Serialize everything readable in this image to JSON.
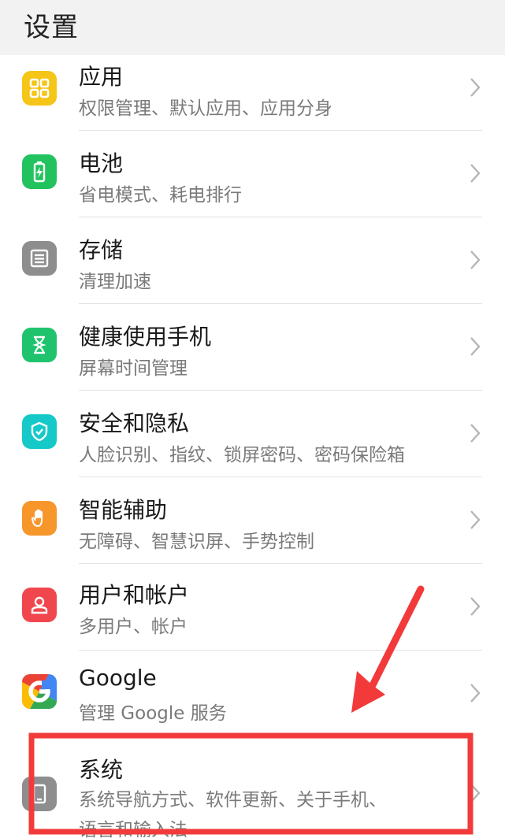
{
  "header": {
    "title": "设置"
  },
  "items": [
    {
      "label": "应用",
      "desc": "权限管理、默认应用、应用分身",
      "icon": "apps-grid-icon",
      "color": "#f5c518"
    },
    {
      "label": "电池",
      "desc": "省电模式、耗电排行",
      "icon": "battery-icon",
      "color": "#22c35e"
    },
    {
      "label": "存储",
      "desc": "清理加速",
      "icon": "storage-icon",
      "color": "#8e8e8e"
    },
    {
      "label": "健康使用手机",
      "desc": "屏幕时间管理",
      "icon": "hourglass-icon",
      "color": "#1fc36e"
    },
    {
      "label": "安全和隐私",
      "desc": "人脸识别、指纹、锁屏密码、密码保险箱",
      "icon": "shield-icon",
      "color": "#16c9c9"
    },
    {
      "label": "智能辅助",
      "desc": "无障碍、智慧识屏、手势控制",
      "icon": "hand-icon",
      "color": "#f7962b"
    },
    {
      "label": "用户和帐户",
      "desc": "多用户、帐户",
      "icon": "user-icon",
      "color": "#f0474e"
    },
    {
      "label": "Google",
      "desc": "管理 Google 服务",
      "icon": "google-icon",
      "color": "#ffffff"
    },
    {
      "label": "系统",
      "desc": "系统导航方式、软件更新、关于手机、",
      "desc2": "语言和输入法",
      "icon": "system-icon",
      "color": "#8e8e8e"
    }
  ],
  "annotation": {
    "color": "#f23a3a"
  }
}
